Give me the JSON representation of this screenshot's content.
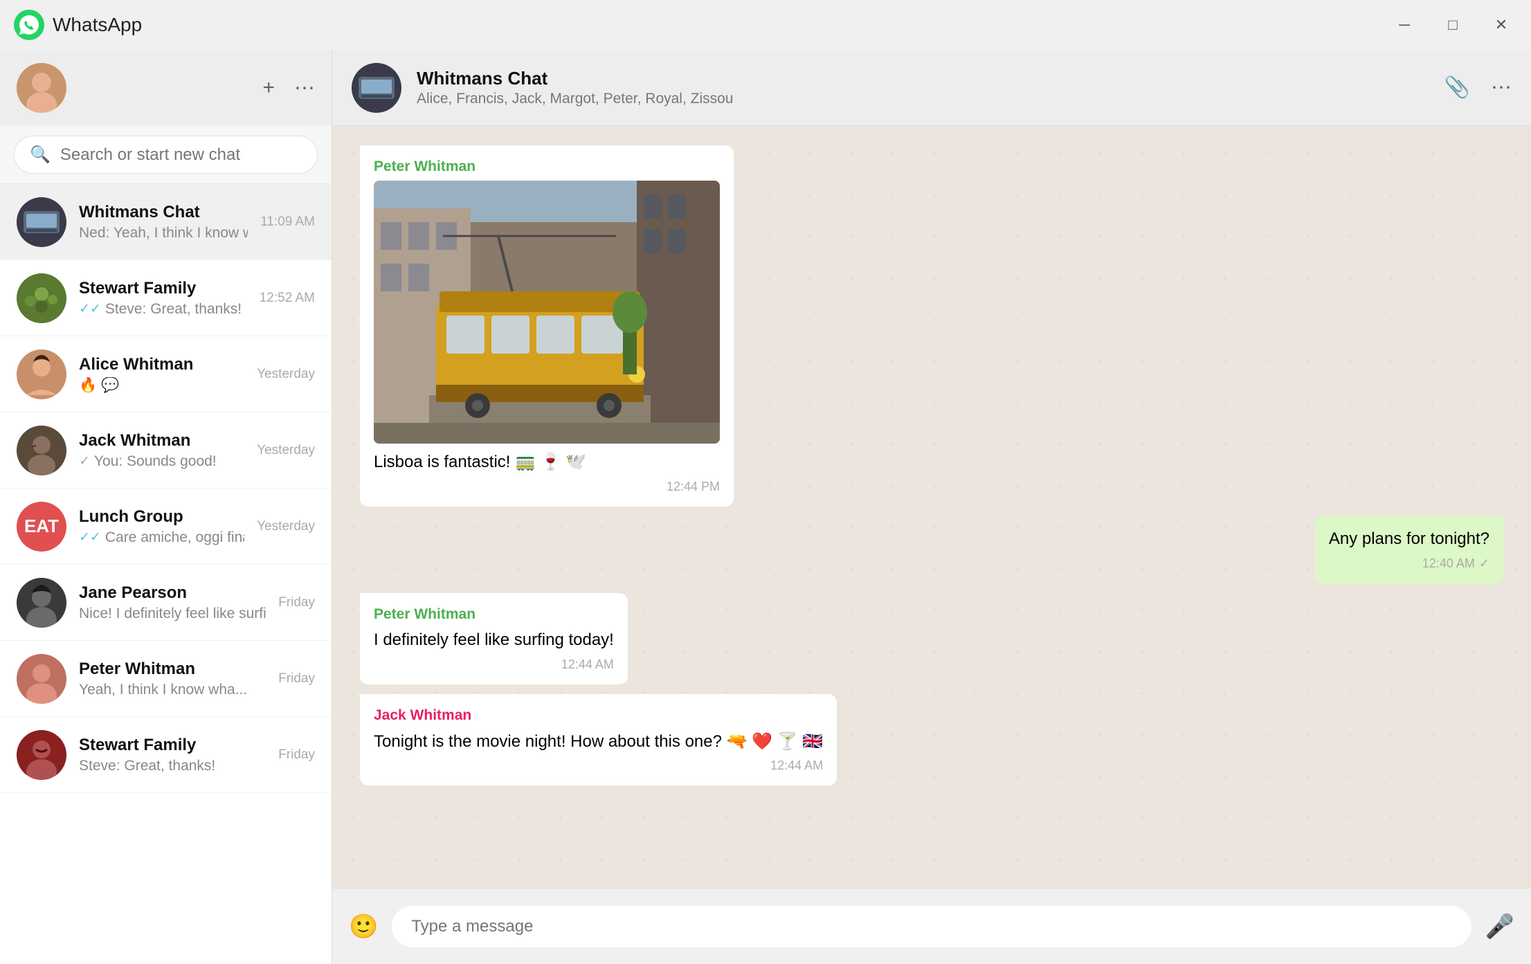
{
  "app": {
    "title": "WhatsApp",
    "logo_emoji": "📱"
  },
  "titlebar": {
    "minimize_label": "─",
    "maximize_label": "□",
    "close_label": "✕"
  },
  "left_header": {
    "new_chat_icon": "+",
    "menu_icon": "⋯",
    "avatar_emoji": "👩"
  },
  "search": {
    "placeholder": "Search or start new chat"
  },
  "chats": [
    {
      "id": "whitmans",
      "name": "Whitmans Chat",
      "preview": "Ned: Yeah, I think I know wha...",
      "time": "11:09 AM",
      "tick": "blue",
      "avatar_type": "whitmans"
    },
    {
      "id": "stewart",
      "name": "Stewart Family",
      "preview": "Steve: Great, thanks!",
      "time": "12:52 AM",
      "tick": "blue",
      "avatar_type": "stewart"
    },
    {
      "id": "alice",
      "name": "Alice Whitman",
      "preview": "🔥 💬",
      "time": "Yesterday",
      "tick": "none",
      "avatar_type": "alice"
    },
    {
      "id": "jack",
      "name": "Jack Whitman",
      "preview": "You: Sounds good!",
      "time": "Yesterday",
      "tick": "gray",
      "avatar_type": "jack"
    },
    {
      "id": "lunch",
      "name": "Lunch Group",
      "preview": "Care amiche, oggi finalmente posso",
      "time": "Yesterday",
      "tick": "blue",
      "avatar_type": "lunch",
      "avatar_text": "EAT"
    },
    {
      "id": "jane",
      "name": "Jane Pearson",
      "preview": "Nice! I definitely feel like surfing",
      "time": "Friday",
      "tick": "none",
      "avatar_type": "jane"
    },
    {
      "id": "peter",
      "name": "Peter Whitman",
      "preview": "Yeah, I think I know wha...",
      "time": "Friday",
      "tick": "none",
      "avatar_type": "peter"
    },
    {
      "id": "stewart2",
      "name": "Stewart Family",
      "preview": "Steve: Great, thanks!",
      "time": "Friday",
      "tick": "none",
      "avatar_type": "stewart2"
    }
  ],
  "active_chat": {
    "name": "Whitmans Chat",
    "members": "Alice, Francis, Jack, Margot, Peter, Royal, Zissou"
  },
  "messages": [
    {
      "id": "msg1",
      "type": "incoming",
      "sender": "Peter Whitman",
      "sender_color": "peter",
      "has_image": true,
      "text": "Lisboa is fantastic! 🚃 🍷 🕊️",
      "time": "12:44 PM",
      "tick": ""
    },
    {
      "id": "msg2",
      "type": "outgoing",
      "sender": "",
      "sender_color": "",
      "has_image": false,
      "text": "Any plans for tonight?",
      "time": "12:40 AM",
      "tick": "✓"
    },
    {
      "id": "msg3",
      "type": "incoming",
      "sender": "Peter Whitman",
      "sender_color": "peter",
      "has_image": false,
      "text": "I definitely feel like surfing today!",
      "time": "12:44 AM",
      "tick": ""
    },
    {
      "id": "msg4",
      "type": "incoming",
      "sender": "Jack Whitman",
      "sender_color": "jack",
      "has_image": false,
      "text": "Tonight is the movie night! How about this one? 🔫 ❤️ 🍸 🇬🇧",
      "time": "12:44 AM",
      "tick": ""
    }
  ],
  "input": {
    "placeholder": "Type a message",
    "emoji_icon": "🙂",
    "mic_icon": "🎤"
  }
}
